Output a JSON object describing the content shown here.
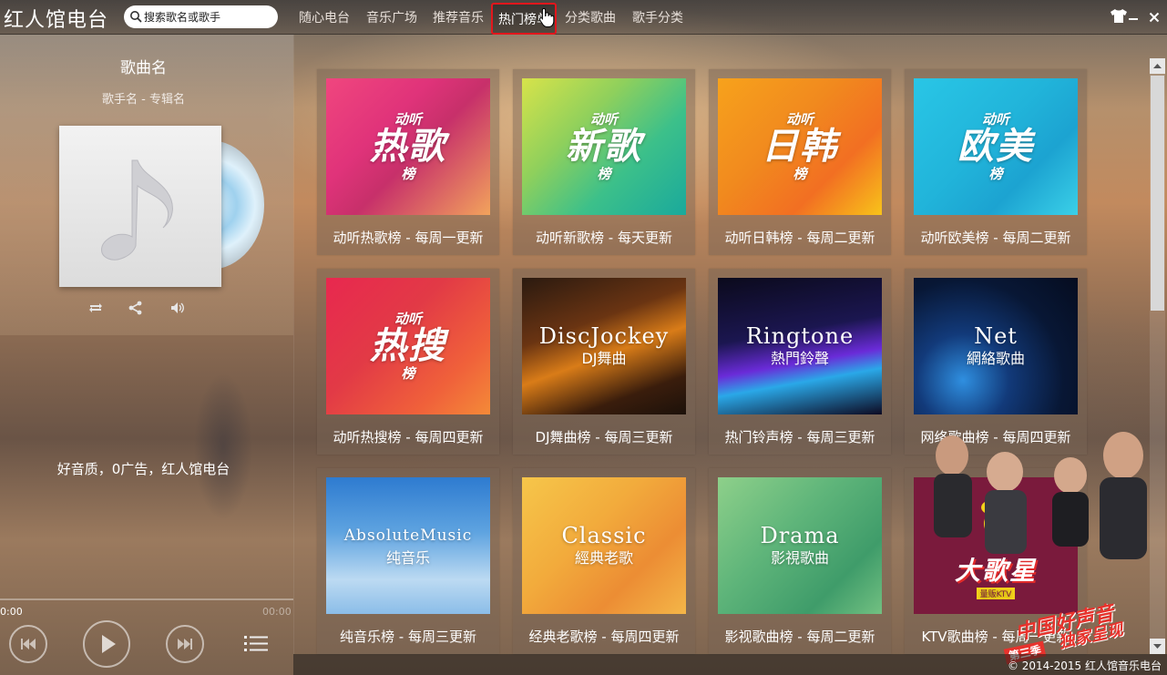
{
  "app": {
    "title": "红人馆电台"
  },
  "search": {
    "placeholder": "搜索歌名或歌手"
  },
  "nav": {
    "items": [
      {
        "label": "随心电台",
        "active": false
      },
      {
        "label": "音乐广场",
        "active": false
      },
      {
        "label": "推荐音乐",
        "active": false
      },
      {
        "label": "热门榜单",
        "active": true
      },
      {
        "label": "分类歌曲",
        "active": false
      },
      {
        "label": "歌手分类",
        "active": false
      }
    ]
  },
  "player": {
    "song_name": "歌曲名",
    "meta": "歌手名 - 专辑名",
    "tagline": "好音质，0广告，红人馆电台",
    "time_current": "0:00",
    "time_total": "00:00",
    "progress": 0
  },
  "charts": [
    {
      "caption": "动听热歌榜 - 每周一更新",
      "cover_small": "动听",
      "cover_big": "热歌",
      "cover_tag": "榜",
      "style": "cn"
    },
    {
      "caption": "动听新歌榜 - 每天更新",
      "cover_small": "动听",
      "cover_big": "新歌",
      "cover_tag": "榜",
      "style": "cn"
    },
    {
      "caption": "动听日韩榜 - 每周二更新",
      "cover_small": "动听",
      "cover_big": "日韩",
      "cover_tag": "榜",
      "style": "cn"
    },
    {
      "caption": "动听欧美榜 - 每周二更新",
      "cover_small": "动听",
      "cover_big": "欧美",
      "cover_tag": "榜",
      "style": "cn"
    },
    {
      "caption": "动听热搜榜 - 每周四更新",
      "cover_small": "动听",
      "cover_big": "热搜",
      "cover_tag": "榜",
      "style": "cn"
    },
    {
      "caption": "DJ舞曲榜 - 每周三更新",
      "cover_big": "DiscJockey",
      "cover_sub": "DJ舞曲",
      "style": "en"
    },
    {
      "caption": "热门铃声榜 - 每周三更新",
      "cover_big": "Ringtone",
      "cover_sub": "熱門鈴聲",
      "style": "en"
    },
    {
      "caption": "网络歌曲榜 - 每周四更新",
      "cover_big": "Net",
      "cover_sub": "網絡歌曲",
      "style": "en"
    },
    {
      "caption": "纯音乐榜 - 每周三更新",
      "cover_big": "AbsoluteMusic",
      "cover_sub": "纯音乐",
      "style": "en"
    },
    {
      "caption": "经典老歌榜 - 每周四更新",
      "cover_big": "Classic",
      "cover_sub": "經典老歌",
      "style": "en"
    },
    {
      "caption": "影视歌曲榜 - 每周二更新",
      "cover_big": "Drama",
      "cover_sub": "影視歌曲",
      "style": "en"
    },
    {
      "caption": "KTV歌曲榜 - 每周一更新",
      "cover_big": "大歌星",
      "cover_sub": "量贩KTV",
      "style": "ktv"
    }
  ],
  "promo": {
    "text": "中国好声音",
    "subtext": "独家呈现",
    "badge": "第三季"
  },
  "footer": {
    "copyright": "© 2014-2015 红人馆音乐电台"
  },
  "colors": {
    "active_border": "#e3161c",
    "card_bg": "#785546"
  }
}
